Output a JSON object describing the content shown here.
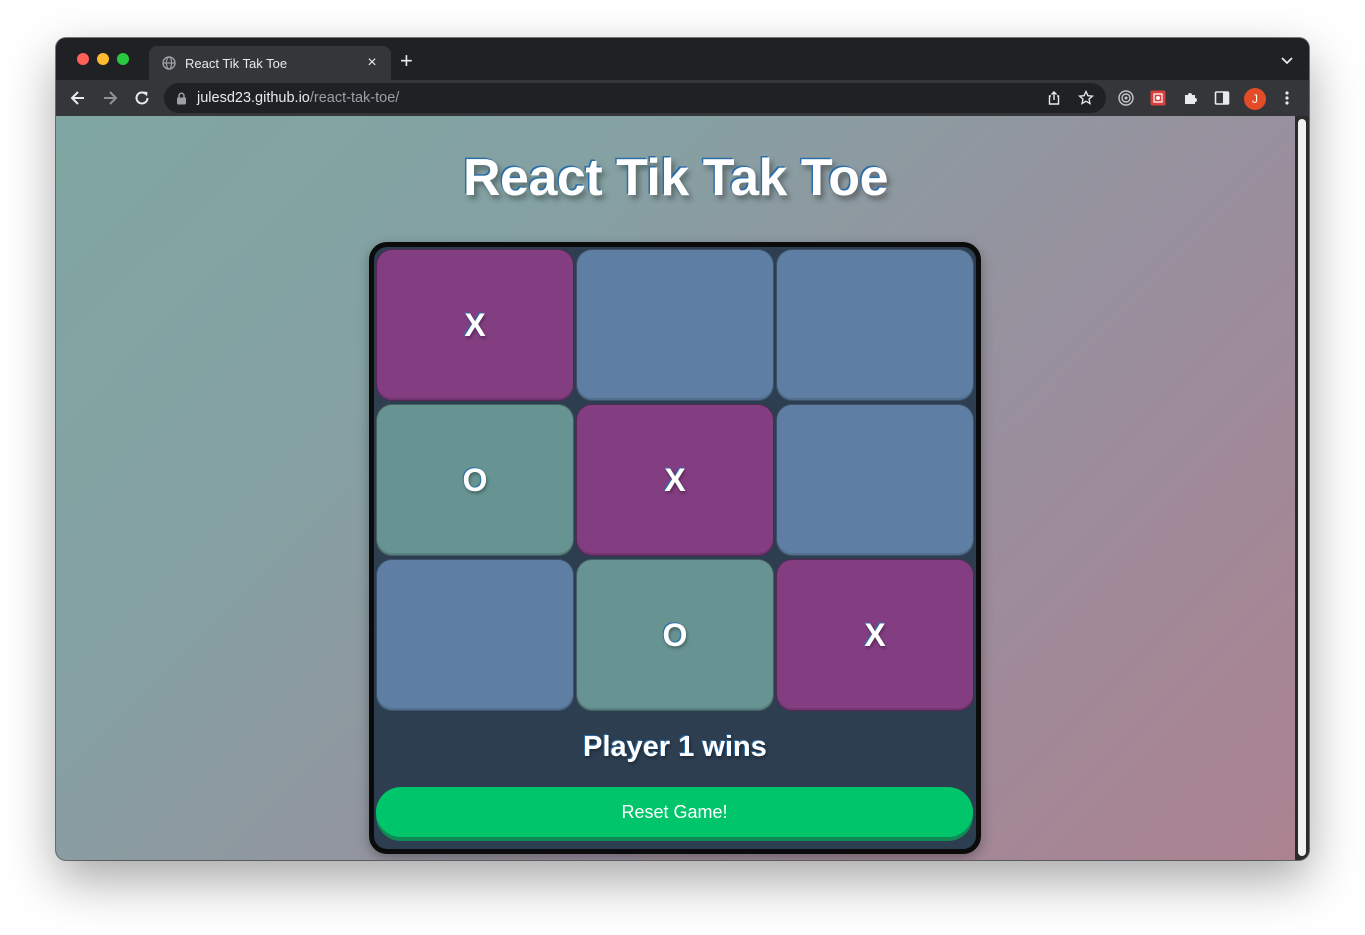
{
  "browser": {
    "tab_title": "React Tik Tak Toe",
    "tab_close": "×",
    "new_tab": "+",
    "url_host": "julesd23.github.io",
    "url_path": "/react-tak-toe/",
    "profile_initial": "J"
  },
  "page": {
    "title": "React Tik Tak Toe",
    "status": "Player 1 wins",
    "reset_label": "Reset Game!"
  },
  "board": {
    "cells": [
      "X",
      "",
      "",
      "O",
      "X",
      "",
      "",
      "O",
      "X"
    ]
  },
  "colors": {
    "x_cell": "#833e82",
    "o_cell": "#679393",
    "empty_cell": "#5e7fa3",
    "board_bg": "#2c3e50",
    "reset_button": "#00c56b"
  }
}
